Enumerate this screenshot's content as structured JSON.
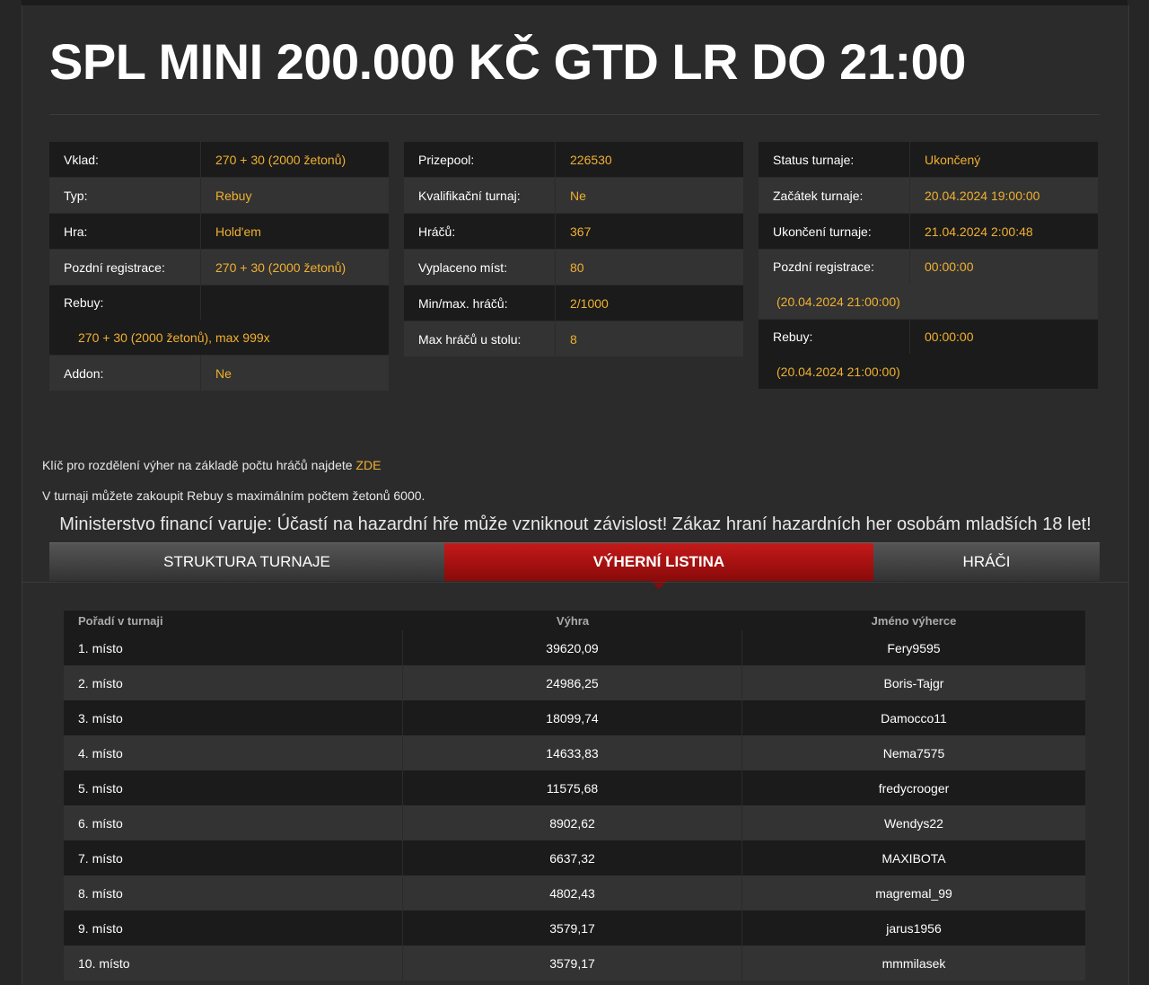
{
  "title": "SPL MINI 200.000 KČ GTD LR DO 21:00",
  "col1": {
    "vklad_label": "Vklad:",
    "vklad_value": "270 + 30 (2000 žetonů)",
    "typ_label": "Typ:",
    "typ_value": "Rebuy",
    "hra_label": "Hra:",
    "hra_value": "Hold'em",
    "pozdni_label": "Pozdní registrace:",
    "pozdni_value": "270 + 30 (2000 žetonů)",
    "rebuy_label": "Rebuy:",
    "rebuy_value": "270 + 30 (2000 žetonů), max 999x",
    "addon_label": "Addon:",
    "addon_value": "Ne"
  },
  "col2": {
    "prizepool_label": "Prizepool:",
    "prizepool_value": "226530",
    "kval_label": "Kvalifikační turnaj:",
    "kval_value": "Ne",
    "hracu_label": "Hráčů:",
    "hracu_value": "367",
    "vyplaceno_label": "Vyplaceno míst:",
    "vyplaceno_value": "80",
    "minmax_label": "Min/max. hráčů:",
    "minmax_value": "2/1000",
    "maxstul_label": "Max hráčů u stolu:",
    "maxstul_value": "8"
  },
  "col3": {
    "status_label": "Status turnaje:",
    "status_value": "Ukončený",
    "zacatek_label": "Začátek turnaje:",
    "zacatek_value": "20.04.2024 19:00:00",
    "ukonceni_label": "Ukončení turnaje:",
    "ukonceni_value": "21.04.2024 2:00:48",
    "pozdni_label": "Pozdní registrace:",
    "pozdni_value": "00:00:00",
    "pozdni_sub": "(20.04.2024 21:00:00)",
    "rebuy_label": "Rebuy:",
    "rebuy_value": "00:00:00",
    "rebuy_sub": "(20.04.2024 21:00:00)"
  },
  "notes": {
    "key_text": "Klíč pro rozdělení výher na základě počtu hráčů najdete ",
    "key_link": "ZDE",
    "rebuy_note": "V turnaji můžete zakoupit Rebuy s maximálním počtem žetonů 6000."
  },
  "warning": "Ministerstvo financí varuje: Účastí na hazardní hře může vzniknout závislost! Zákaz hraní hazardních her osobám mladších 18 let!",
  "tabs": [
    "STRUKTURA TURNAJE",
    "VÝHERNÍ LISTINA",
    "HRÁČI"
  ],
  "results": {
    "headers": [
      "Pořadí v turnaji",
      "Výhra",
      "Jméno výherce"
    ],
    "rows": [
      [
        "1. místo",
        "39620,09",
        "Fery9595"
      ],
      [
        "2. místo",
        "24986,25",
        "Boris-Tajgr"
      ],
      [
        "3. místo",
        "18099,74",
        "Damocco11"
      ],
      [
        "4. místo",
        "14633,83",
        "Nema7575"
      ],
      [
        "5. místo",
        "11575,68",
        "fredycrooger"
      ],
      [
        "6. místo",
        "8902,62",
        "Wendys22"
      ],
      [
        "7. místo",
        "6637,32",
        "MAXIBOTA"
      ],
      [
        "8. místo",
        "4802,43",
        "magremal_99"
      ],
      [
        "9. místo",
        "3579,17",
        "jarus1956"
      ],
      [
        "10. místo",
        "3579,17",
        "mmmilasek"
      ]
    ]
  }
}
